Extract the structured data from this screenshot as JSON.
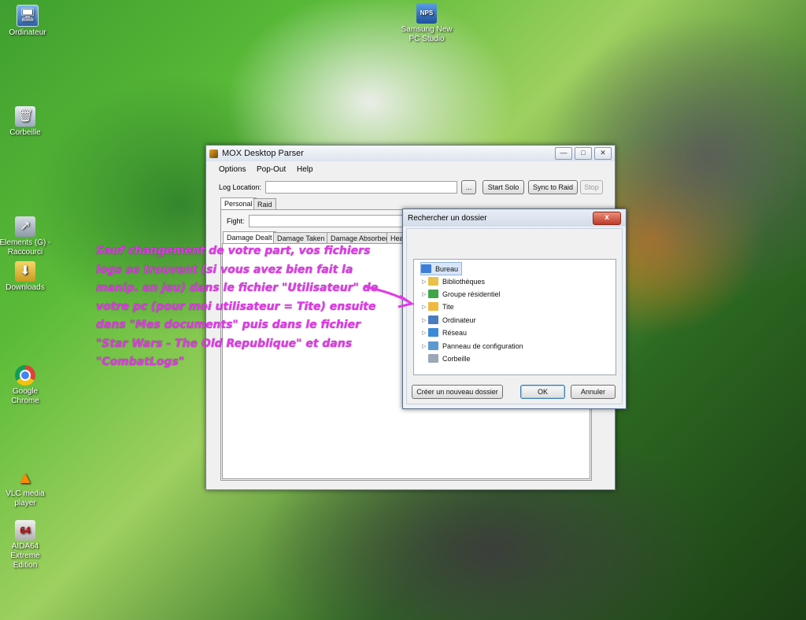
{
  "desktop": {
    "icons": [
      {
        "label": "Ordinateur",
        "icon": "computer-icon"
      },
      {
        "label": "Corbeille",
        "icon": "recycle-bin-icon"
      },
      {
        "label": "Elements (G) - Raccourci",
        "icon": "drive-shortcut-icon"
      },
      {
        "label": "Downloads",
        "icon": "downloads-folder-icon"
      },
      {
        "label": "Google Chrome",
        "icon": "chrome-icon"
      },
      {
        "label": "VLC media player",
        "icon": "vlc-icon"
      },
      {
        "label": "AIDA64 Extreme Edition",
        "icon": "aida64-icon"
      },
      {
        "label": "Samsung New PC Studio",
        "icon": "samsung-npcs-icon",
        "badge": "NPS"
      }
    ]
  },
  "parser": {
    "title": "MOX Desktop Parser",
    "menu": [
      "Options",
      "Pop-Out",
      "Help"
    ],
    "log_location_label": "Log Location:",
    "log_location_value": "",
    "browse_label": "...",
    "start_solo": "Start Solo",
    "sync_to_raid": "Sync to Raid",
    "stop": "Stop",
    "tabs": [
      "Personal",
      "Raid"
    ],
    "fight_label": "Fight:",
    "subtabs": [
      "Damage Dealt",
      "Damage Taken",
      "Damage Absorbed",
      "Hea"
    ]
  },
  "folder_dialog": {
    "title": "Rechercher un dossier",
    "close": "x",
    "tree": [
      {
        "label": "Bureau",
        "selected": true,
        "expander": false,
        "color": "#3b7dd8"
      },
      {
        "label": "Bibliothèques",
        "expander": true,
        "color": "#e8c04a"
      },
      {
        "label": "Groupe résidentiel",
        "expander": true,
        "color": "#3fa548"
      },
      {
        "label": "Tite",
        "expander": true,
        "color": "#f0b840"
      },
      {
        "label": "Ordinateur",
        "expander": true,
        "color": "#4a7cc0"
      },
      {
        "label": "Réseau",
        "expander": true,
        "color": "#3a8ad8"
      },
      {
        "label": "Panneau de configuration",
        "expander": true,
        "color": "#5a9ad0"
      },
      {
        "label": "Corbeille",
        "expander": false,
        "color": "#9aa8b8"
      }
    ],
    "new_folder": "Créer un nouveau dossier",
    "ok": "OK",
    "cancel": "Annuler"
  },
  "annotation": {
    "text": "Sauf changement de votre part, vos fichiers logs se trouvent (si vous avez bien fait la manip. en jeu) dans le fichier \"Utilisateur\" de votre pc (pour moi utilisateur = Tite) ensuite dans \"Mes documents\" puis dans le fichier \"Star Wars - The Old Republique\" et dans \"CombatLogs\"",
    "color": "#e03ae8"
  }
}
